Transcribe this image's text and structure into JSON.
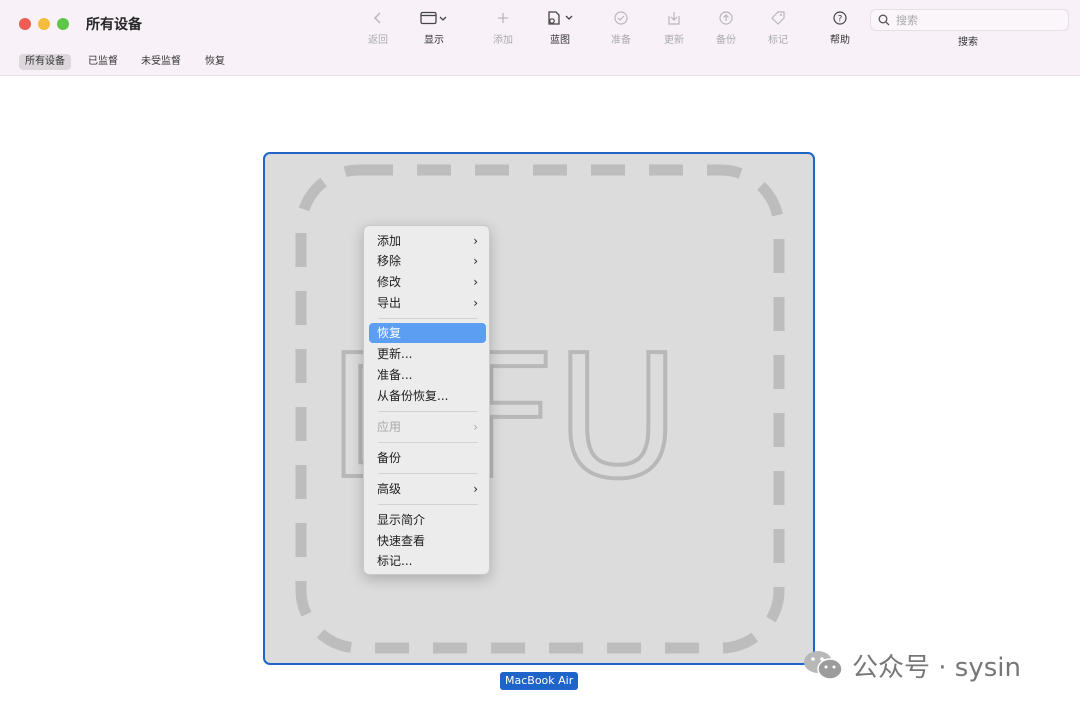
{
  "window": {
    "title": "所有设备"
  },
  "toolbar": {
    "back": "返回",
    "display": "显示",
    "add": "添加",
    "blueprint": "蓝图",
    "prepare": "准备",
    "update": "更新",
    "backup": "备份",
    "tag": "标记",
    "help": "帮助",
    "search_label": "搜索",
    "search_placeholder": "搜索"
  },
  "tabs": [
    "所有设备",
    "已监督",
    "未受监督",
    "恢复"
  ],
  "device": {
    "mode_text": "DFU",
    "name": "MacBook Air"
  },
  "context_menu": {
    "items": [
      {
        "label": "添加",
        "submenu": true
      },
      {
        "label": "移除",
        "submenu": true
      },
      {
        "label": "修改",
        "submenu": true
      },
      {
        "label": "导出",
        "submenu": true
      },
      {
        "label": "恢复",
        "highlighted": true
      },
      {
        "label": "更新..."
      },
      {
        "label": "准备..."
      },
      {
        "label": "从备份恢复..."
      },
      {
        "label": "应用",
        "submenu": true,
        "disabled": true
      },
      {
        "label": "备份"
      },
      {
        "label": "高级",
        "submenu": true
      },
      {
        "label": "显示简介"
      },
      {
        "label": "快速查看"
      },
      {
        "label": "标记..."
      }
    ]
  },
  "watermark": {
    "text": "公众号 · sysin"
  },
  "colors": {
    "selection": "#1f64c8",
    "menu_highlight": "#5c9ff2",
    "titlebar": "#f8f2f8"
  }
}
